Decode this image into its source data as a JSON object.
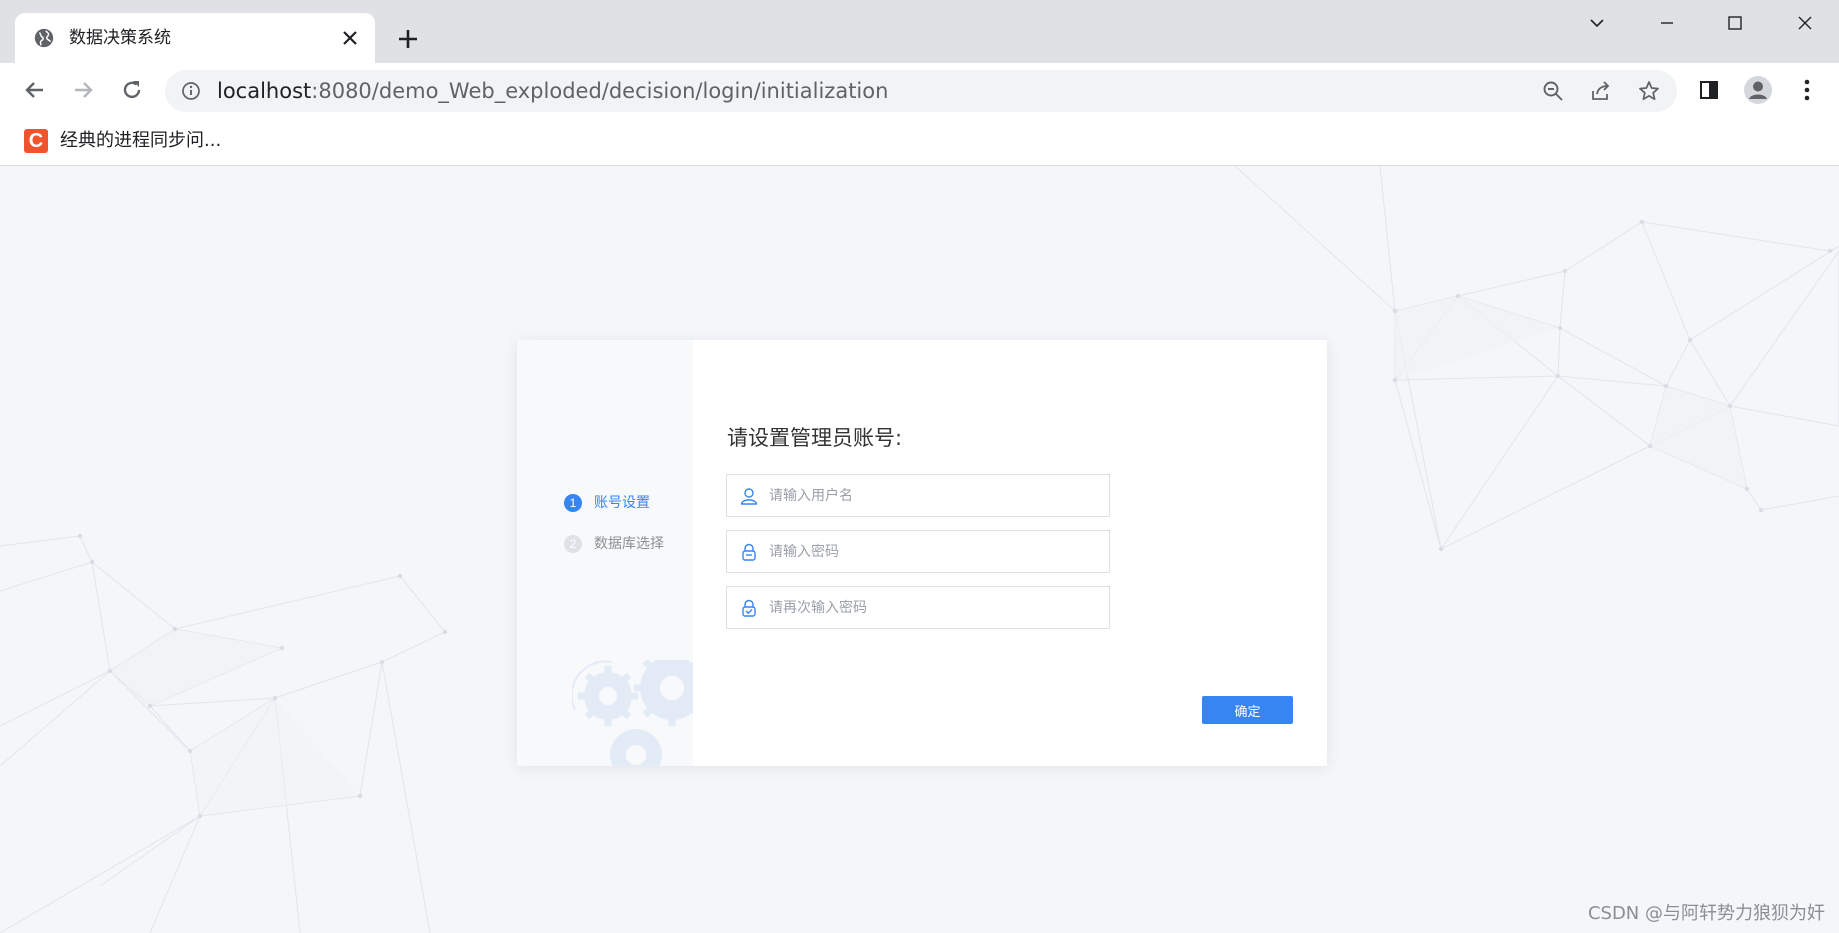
{
  "browser": {
    "tab": {
      "title": "数据决策系统",
      "favicon": "globe-icon"
    },
    "address": {
      "host": "localhost",
      "path": ":8080/demo_Web_exploded/decision/login/initialization"
    },
    "bookmark": {
      "label": "经典的进程同步问...",
      "icon_letter": "C",
      "icon_color": "#f0542f"
    }
  },
  "setup": {
    "steps": [
      {
        "number": "1",
        "label": "账号设置",
        "active": true
      },
      {
        "number": "2",
        "label": "数据库选择",
        "active": false
      }
    ],
    "title": "请设置管理员账号:",
    "fields": {
      "username_placeholder": "请输入用户名",
      "password_placeholder": "请输入密码",
      "confirm_password_placeholder": "请再次输入密码"
    },
    "confirm_label": "确定"
  },
  "watermark": "CSDN @与阿轩势力狼狈为奸",
  "colors": {
    "accent": "#3685f2",
    "inactive_step": "#c9ccd1",
    "step_label_inactive": "#8c9096"
  }
}
